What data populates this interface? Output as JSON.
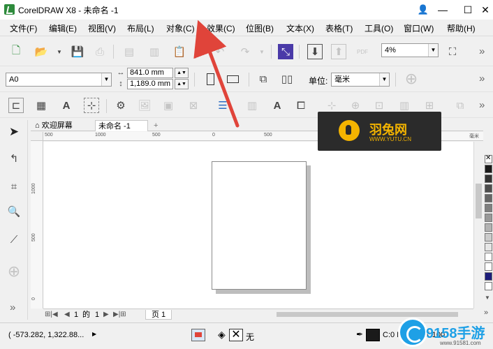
{
  "window": {
    "title": "CorelDRAW X8 - 未命名 -1",
    "minimize": "—",
    "maximize": "☐",
    "close": "✕"
  },
  "menu": [
    "文件(F)",
    "编辑(E)",
    "视图(V)",
    "布局(L)",
    "对象(C)",
    "效果(C)",
    "位图(B)",
    "文本(X)",
    "表格(T)",
    "工具(O)",
    "窗口(W)",
    "帮助(H)"
  ],
  "toolbar1": {
    "zoom": "4%",
    "pdf": "PDF"
  },
  "propertybar": {
    "page_size": "A0",
    "width": "841.0 mm",
    "height": "1,189.0 mm",
    "unit_label": "单位:",
    "unit_value": "毫米"
  },
  "document_tabs": {
    "welcome": "欢迎屏幕",
    "document": "未命名 -1",
    "add": "+"
  },
  "rulers": {
    "h_labels": [
      "500",
      "1000",
      "500",
      "0",
      "500",
      "毫米"
    ],
    "v_labels": [
      "1000",
      "500",
      "0"
    ]
  },
  "page_nav": {
    "current": "1",
    "of": "的",
    "total": "1",
    "page_tab": "页 1"
  },
  "status": {
    "coords": "( -573.282, 1,322.88...",
    "fill_label": "无",
    "outline_label": "C:0 M:0 Y:0 K:100"
  },
  "overlay_logo": {
    "name": "羽兔网",
    "url": "WWW.YUTU.CN"
  },
  "watermark": {
    "text": "9158手游",
    "url": "www.91581.com"
  },
  "colors": {
    "accent_red": "#e0443a",
    "logo_bg": "#2b2b2b",
    "logo_fg": "#f4b400",
    "watermark_blue": "#1ea0e6"
  }
}
